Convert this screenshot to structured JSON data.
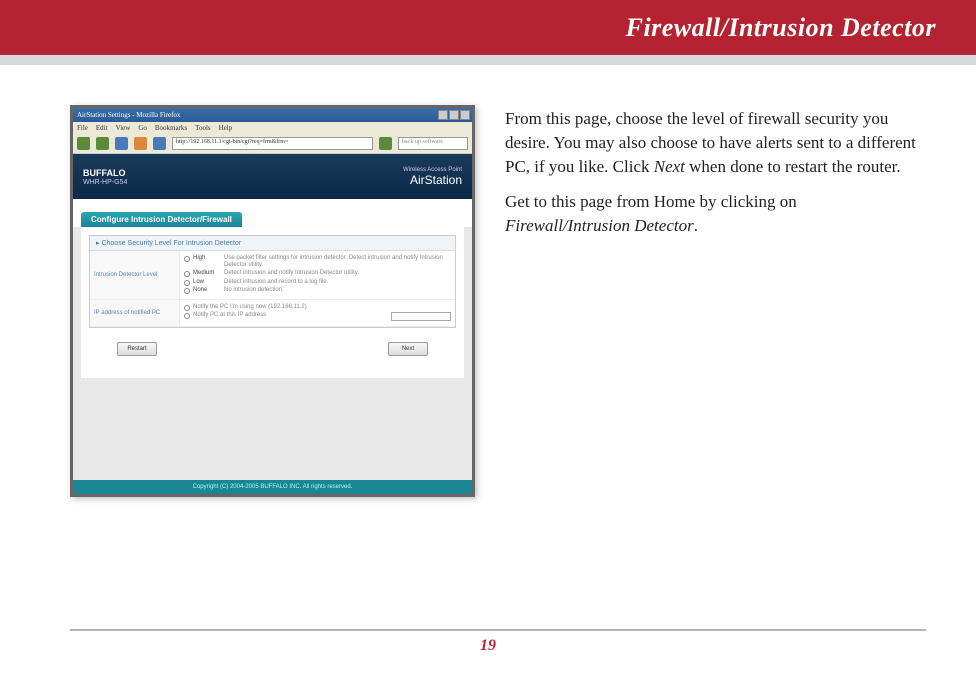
{
  "header": {
    "title": "Firewall/Intrusion Detector"
  },
  "body": {
    "paragraph1_a": "From this page, choose the level of firewall security you desire.   You may also choose to have alerts sent to a different PC, if you like.  Click ",
    "paragraph1_next": "Next",
    "paragraph1_b": " when done to restart the router.",
    "paragraph2_a": "Get to this page from Home by clicking on ",
    "paragraph2_link": "Firewall/Intrusion Detector"
  },
  "screenshot": {
    "window_title": "AirStation Settings - Mozilla Firefox",
    "menus": [
      "File",
      "Edit",
      "View",
      "Go",
      "Bookmarks",
      "Tools",
      "Help"
    ],
    "url": "http://192.168.11.1/cgi-bin/cgi?req=frm&frm=",
    "search_placeholder": "back up software",
    "brand": "BUFFALO",
    "brand_sub": "WHR-HP-G54",
    "product": "AirStation",
    "product_sub": "Wireless Access Point",
    "panel_title": "Configure Intrusion Detector/Firewall",
    "sub_header": "Choose Security Level For Intrusion Detector",
    "row1_label": "Intrusion Detector Level",
    "levels": [
      {
        "name": "High",
        "desc": "Use packet filter settings for intrusion detector. Detect intrusion and notify Intrusion Detector utility."
      },
      {
        "name": "Medium",
        "desc": "Detect intrusion and notify Intrusion Detector utility."
      },
      {
        "name": "Low",
        "desc": "Detect intrusion and record to a log file."
      },
      {
        "name": "None",
        "desc": "No intrusion detection."
      }
    ],
    "row2_label": "IP address of notified PC",
    "notify_options": [
      "Notify the PC I'm using now (192.168.11.2)",
      "Notify PC at this IP address"
    ],
    "button_restart": "Restart",
    "button_next": "Next",
    "copyright": "Copyright (C) 2004-2005 BUFFALO INC. All rights reserved."
  },
  "page_number": "19"
}
